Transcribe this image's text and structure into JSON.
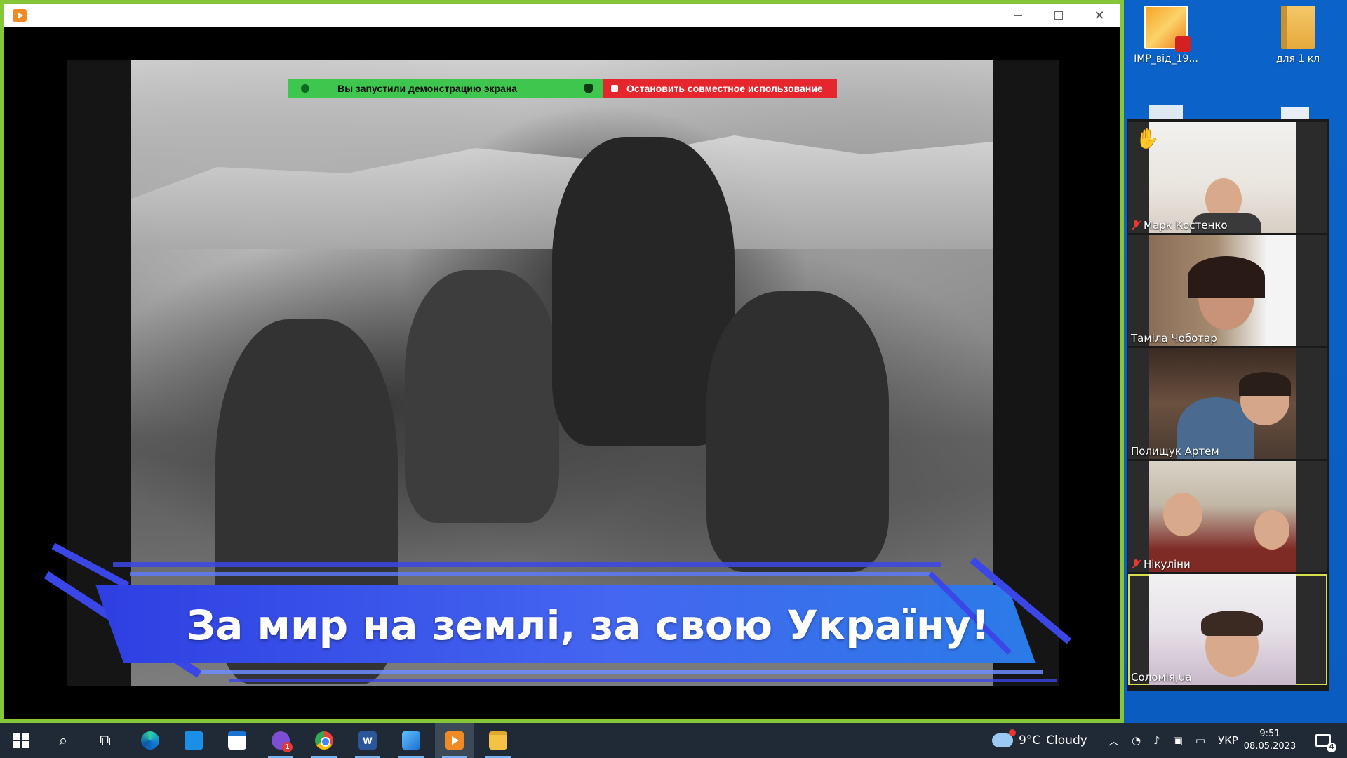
{
  "desktop": {
    "icons": [
      {
        "label": "ІМР_від_19...",
        "type": "pdf"
      },
      {
        "label": "для 1 кл",
        "type": "folder"
      }
    ]
  },
  "window": {
    "share_banner": {
      "status_text": "Вы запустили демонстрацию экрана",
      "stop_label": "Остановить совместное использование"
    },
    "slide_caption": "За мир на землі, за свою Україну!"
  },
  "participants": [
    {
      "name": "Марк Костенко",
      "muted": true,
      "hand_raised": true,
      "active": false
    },
    {
      "name": "Таміла Чоботар",
      "muted": false,
      "hand_raised": false,
      "active": false
    },
    {
      "name": "Полищук Артем",
      "muted": false,
      "hand_raised": false,
      "active": false
    },
    {
      "name": "Нікуліни",
      "muted": true,
      "hand_raised": false,
      "active": false
    },
    {
      "name": "Соломія,ua",
      "muted": false,
      "hand_raised": false,
      "active": true
    }
  ],
  "taskbar": {
    "apps": [
      {
        "name": "start",
        "icon": "windows-logo-icon"
      },
      {
        "name": "search",
        "icon": "search-icon"
      },
      {
        "name": "task-view",
        "icon": "task-view-icon"
      },
      {
        "name": "edge",
        "icon": "edge-icon"
      },
      {
        "name": "mail",
        "icon": "mail-icon"
      },
      {
        "name": "store",
        "icon": "store-icon"
      },
      {
        "name": "viber",
        "icon": "viber-icon",
        "badge": "1"
      },
      {
        "name": "chrome",
        "icon": "chrome-icon"
      },
      {
        "name": "word",
        "icon": "word-icon",
        "letter": "W"
      },
      {
        "name": "photos",
        "icon": "photos-icon"
      },
      {
        "name": "zoom",
        "icon": "zoom-icon"
      },
      {
        "name": "file-explorer",
        "icon": "folder-icon"
      }
    ],
    "weather": {
      "temp": "9°C",
      "condition": "Cloudy"
    },
    "language": "УКР",
    "time": "9:51",
    "date": "08.05.2023",
    "notification_count": "4"
  },
  "colors": {
    "window_border": "#86c73a",
    "share_green": "#3fc64f",
    "share_red": "#e5262c",
    "ribbon_blue": "#3b46e6",
    "taskbar_bg": "#1f2a36"
  }
}
